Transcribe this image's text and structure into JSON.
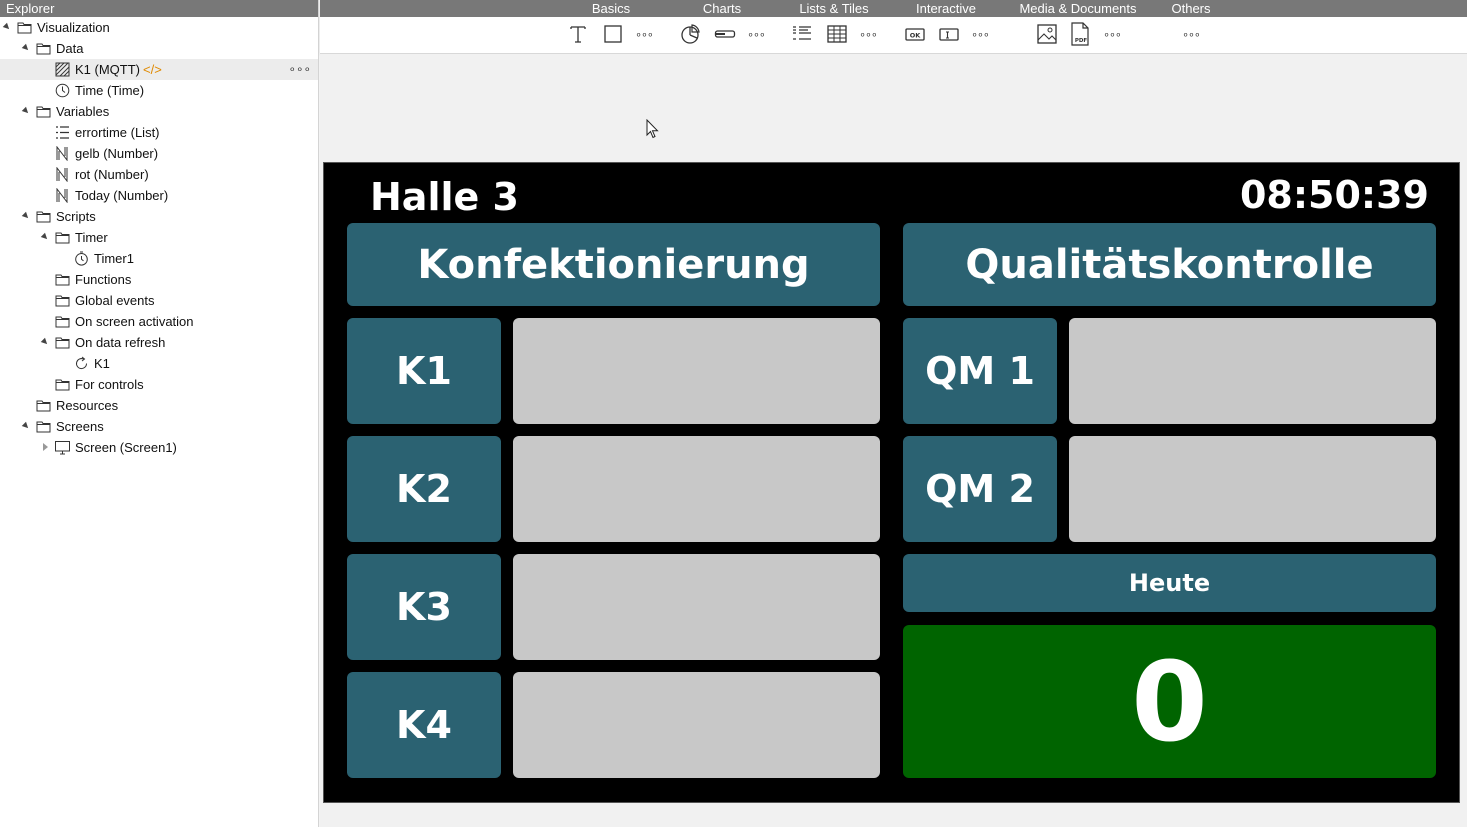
{
  "explorer": {
    "title": "Explorer",
    "nodes": [
      {
        "label": "Visualization"
      },
      {
        "label": "Data"
      },
      {
        "label": "K1 (MQTT)",
        "tag": "</>",
        "more": "∘∘∘"
      },
      {
        "label": "Time (Time)"
      },
      {
        "label": "Variables"
      },
      {
        "label": "errortime (List)"
      },
      {
        "label": "gelb (Number)"
      },
      {
        "label": "rot (Number)"
      },
      {
        "label": "Today (Number)"
      },
      {
        "label": "Scripts"
      },
      {
        "label": "Timer"
      },
      {
        "label": "Timer1"
      },
      {
        "label": "Functions"
      },
      {
        "label": "Global events"
      },
      {
        "label": "On screen activation"
      },
      {
        "label": "On data refresh"
      },
      {
        "label": "K1"
      },
      {
        "label": "For controls"
      },
      {
        "label": "Resources"
      },
      {
        "label": "Screens"
      },
      {
        "label": "Screen (Screen1)"
      }
    ]
  },
  "toolbar": {
    "categories": [
      "Basics",
      "Charts",
      "Lists & Tiles",
      "Interactive",
      "Media & Documents",
      "Others"
    ],
    "more": "∘∘∘",
    "tools": [
      "text-tool-icon",
      "rectangle-tool-icon",
      "pie-chart-tool-icon",
      "progress-bar-tool-icon",
      "list-tool-icon",
      "table-tool-icon",
      "ok-button-tool-icon",
      "input-field-tool-icon",
      "image-tool-icon",
      "pdf-tool-icon"
    ]
  },
  "screen": {
    "hall_title": "Halle 3",
    "clock": "08:50:39",
    "left_header": "Konfektionierung",
    "right_header": "Qualitätskontrolle",
    "left_stations": [
      "K1",
      "K2",
      "K3",
      "K4"
    ],
    "right_stations": [
      "QM 1",
      "QM 2"
    ],
    "today_label": "Heute",
    "today_value": "0",
    "colors": {
      "background": "#000000",
      "panel": "#2b6272",
      "slot": "#c8c8c8",
      "today": "#006400"
    }
  }
}
